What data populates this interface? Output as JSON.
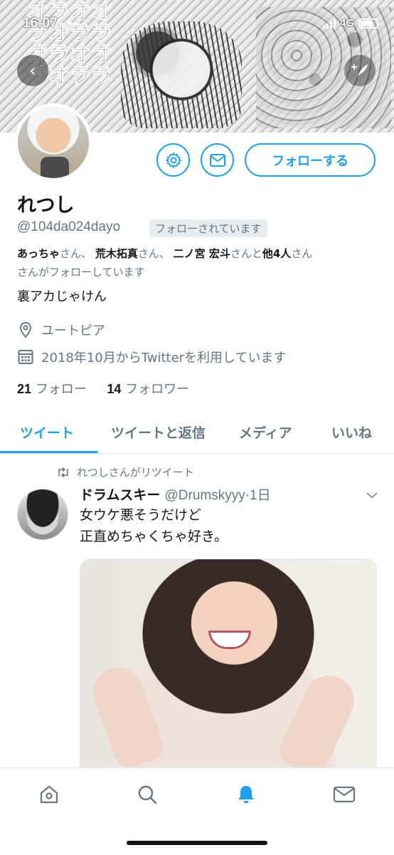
{
  "status_bar": {
    "time": "16:07",
    "network": "4G"
  },
  "banner": {
    "manga_columns": [
      "オラオラ",
      "ラオラオ",
      "オラオラ",
      "オラオラ",
      "ラオラオ"
    ]
  },
  "profile": {
    "name": "れつし",
    "handle": "@104da024dayo",
    "follows_you_badge": "フォローされています",
    "followed_by": {
      "name1": "あっちゃ",
      "name2": "荒木拓真",
      "name3": "二ノ宮 宏斗",
      "others": "他4人",
      "suffix1": "さん、",
      "suffix2": "さん、",
      "suffix3": "さんと",
      "suffix4": "さん",
      "tail": "さんがフォローしています"
    },
    "bio": "裏アカじゃけん",
    "location": "ユートピア",
    "joined": "2018年10月からTwitterを利用しています",
    "following_count": "21",
    "following_label": "フォロー",
    "followers_count": "14",
    "followers_label": "フォロワー",
    "follow_button": "フォローする"
  },
  "tabs": [
    {
      "label": "ツイート",
      "active": true
    },
    {
      "label": "ツイートと返信",
      "active": false
    },
    {
      "label": "メディア",
      "active": false
    },
    {
      "label": "いいね",
      "active": false
    }
  ],
  "tweet": {
    "retweet_label": "れつしさんがリツイート",
    "display_name": "ドラムスキー",
    "screen_name": "@Drumskyyy",
    "time": "·1日",
    "line1": "女ウケ悪そうだけど",
    "line2": "正直めちゃくちゃ好き。"
  },
  "colors": {
    "accent": "#1da1f2",
    "secondary_text": "#657786",
    "primary_text": "#14171a"
  },
  "icons": {
    "back": "back-arrow-icon",
    "compose": "compose-feather-icon",
    "settings": "gear-icon",
    "message": "envelope-icon",
    "location": "location-pin-icon",
    "calendar": "calendar-icon",
    "retweet": "retweet-icon",
    "caret": "chevron-down-icon",
    "nav": [
      "home-icon",
      "search-icon",
      "notifications-bell-icon",
      "messages-envelope-icon"
    ]
  }
}
